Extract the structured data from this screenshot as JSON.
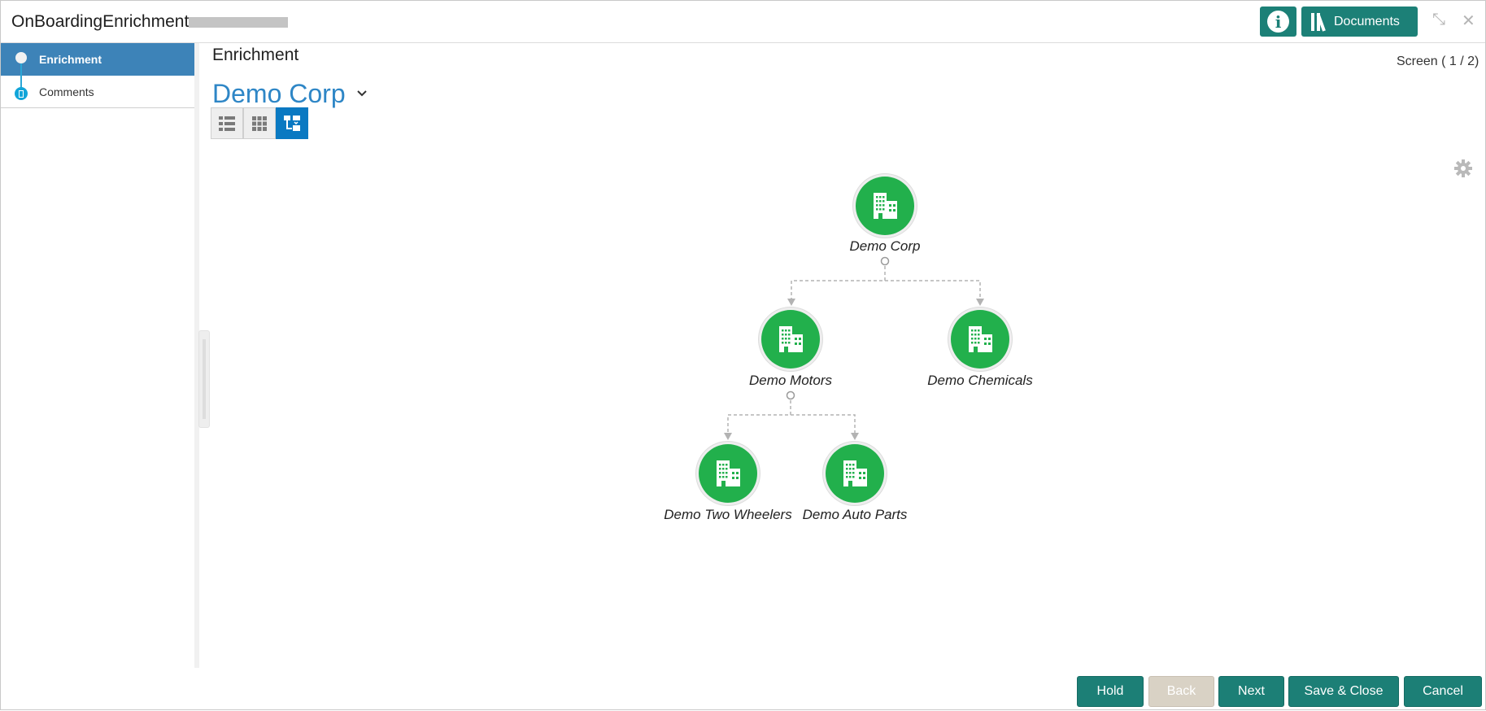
{
  "header": {
    "title": "OnBoardingEnrichment -",
    "documents_label": "Documents",
    "info_glyph": "i",
    "minimize_glyph": "⤡",
    "close_glyph": "✕"
  },
  "sidebar": {
    "items": [
      {
        "label": "Enrichment",
        "active": true
      },
      {
        "label": "Comments",
        "active": false
      }
    ]
  },
  "main": {
    "section_title": "Enrichment",
    "screen_indicator": "Screen ( 1 / 2)",
    "entity_name": "Demo Corp",
    "view_modes": [
      {
        "icon": "list-view-icon",
        "active": false
      },
      {
        "icon": "grid-view-icon",
        "active": false
      },
      {
        "icon": "hierarchy-view-icon",
        "active": true
      }
    ]
  },
  "hierarchy": {
    "nodes": [
      {
        "label": "Demo Corp",
        "icon": "building-icon"
      },
      {
        "label": "Demo Motors",
        "icon": "building-icon"
      },
      {
        "label": "Demo Chemicals",
        "icon": "building-icon"
      },
      {
        "label": "Demo Two Wheelers",
        "icon": "building-icon"
      },
      {
        "label": "Demo Auto Parts",
        "icon": "building-icon"
      }
    ],
    "edges": [
      {
        "from": "Demo Corp",
        "to": "Demo Motors"
      },
      {
        "from": "Demo Corp",
        "to": "Demo Chemicals"
      },
      {
        "from": "Demo Motors",
        "to": "Demo Two Wheelers"
      },
      {
        "from": "Demo Motors",
        "to": "Demo Auto Parts"
      }
    ]
  },
  "footer": {
    "hold": "Hold",
    "back": "Back",
    "next": "Next",
    "save_close": "Save & Close",
    "cancel": "Cancel"
  },
  "colors": {
    "primary": "#1c7f76",
    "sidebar_active": "#3d83b8",
    "entity_title": "#2e86c6",
    "node_green": "#22b04c",
    "toggle_active": "#0a79c2"
  }
}
